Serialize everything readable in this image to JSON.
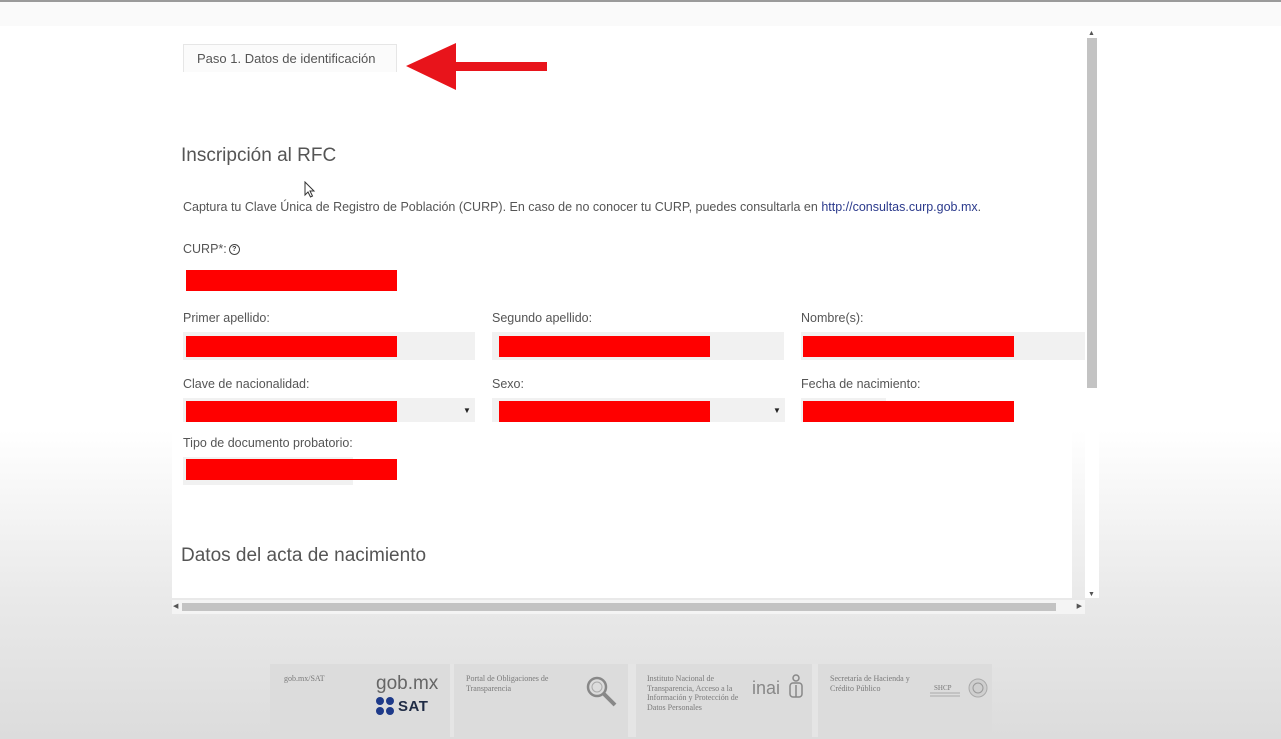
{
  "tab": {
    "label": "Paso 1. Datos de identificación"
  },
  "form": {
    "title": "Inscripción al RFC",
    "description_prefix": "Captura tu Clave Única de Registro de Población (CURP). En caso de no conocer tu CURP, puedes consultarla en ",
    "description_link": "http://consultas.curp.gob.mx",
    "description_suffix": ".",
    "curp_label": "CURP*:",
    "help_icon": "?",
    "fields": {
      "primer_apellido": "Primer apellido:",
      "segundo_apellido": "Segundo apellido:",
      "nombres": "Nombre(s):",
      "clave_nacionalidad": "Clave de nacionalidad:",
      "sexo": "Sexo:",
      "fecha_nacimiento": "Fecha de nacimiento:",
      "tipo_documento": "Tipo de documento probatorio:"
    },
    "dropdown_arrow": "▼"
  },
  "section2": {
    "title": "Datos del acta de nacimiento"
  },
  "scroll": {
    "up": "▲",
    "down": "▼",
    "left": "◀",
    "right": "▶"
  },
  "footer": {
    "gob_sat_caption": "gob.mx/SAT",
    "gob_logo": "gob.mx",
    "sat_logo": "SAT",
    "portal_caption": "Portal de Obligaciones de Transparencia",
    "inai_caption": "Instituto Nacional de Transparencia, Acceso a la Información y Protección de Datos Personales",
    "inai_logo": "inai",
    "shcp_caption": "Secretaría de Hacienda y Crédito Público",
    "shcp_logo": "SHCP"
  },
  "colors": {
    "redaction": "#ff0000",
    "annotation_arrow": "#e8141b",
    "link": "#2b3a8c"
  }
}
